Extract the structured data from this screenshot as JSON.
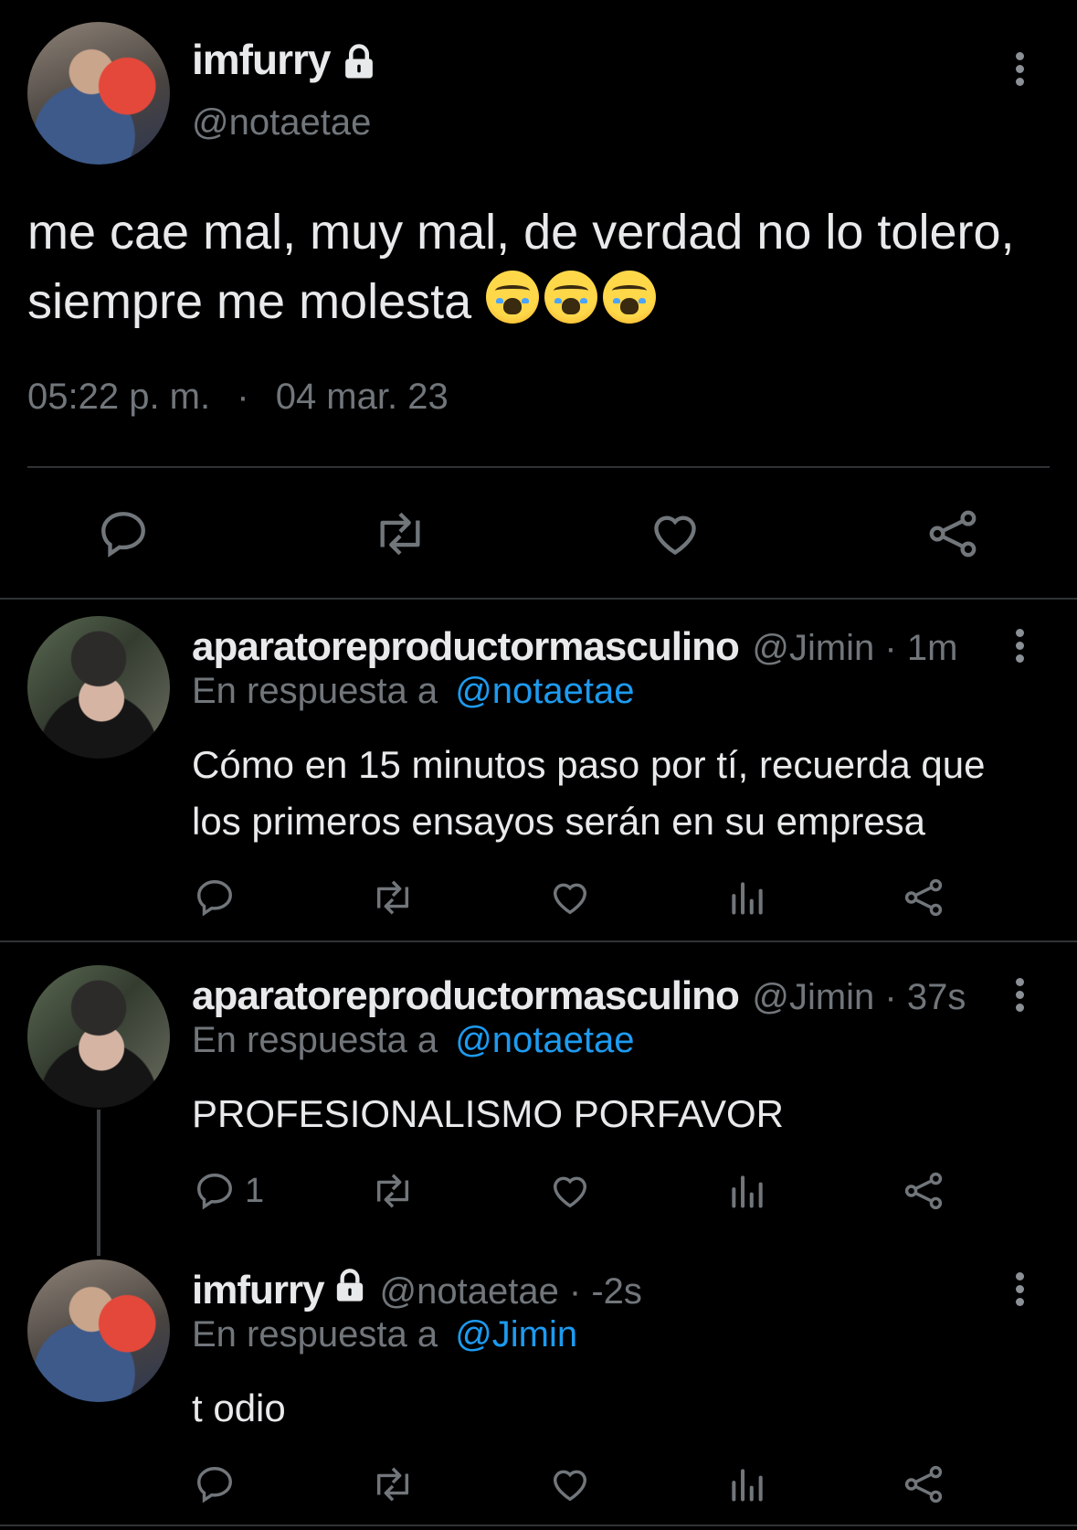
{
  "main_tweet": {
    "display_name": "imfurry",
    "handle": "@notaetae",
    "text_line1": "me cae mal, muy mal, de verdad no lo tolero,",
    "text_line2": "siempre me molesta",
    "emojis": [
      "loudly-crying-face",
      "loudly-crying-face",
      "loudly-crying-face"
    ],
    "time": "05:22 p. m.",
    "separator": "·",
    "date": "04 mar. 23"
  },
  "replies": [
    {
      "display_name": "aparatoreproductormasculino",
      "handle_meta": "@Jimin · 1m",
      "reply_to_label": "En respuesta a",
      "reply_to_handle": "@notaetae",
      "text_line1": "Cómo en 15 minutos paso por tí, recuerda que",
      "text_line2": "los primeros ensayos serán en su empresa",
      "reply_count": ""
    },
    {
      "display_name": "aparatoreproductormasculino",
      "handle_meta": "@Jimin · 37s",
      "reply_to_label": "En respuesta a",
      "reply_to_handle": "@notaetae",
      "text_line1": "PROFESIONALISMO PORFAVOR",
      "reply_count": "1"
    },
    {
      "display_name": "imfurry",
      "handle_meta": "@notaetae · -2s",
      "reply_to_label": "En respuesta a",
      "reply_to_handle": "@Jimin",
      "text_line1": "t odio",
      "reply_count": ""
    }
  ],
  "colors": {
    "background": "#000000",
    "text": "#e7e9ea",
    "muted": "#71767b",
    "link": "#1d9bf0",
    "divider": "#2f3336"
  }
}
